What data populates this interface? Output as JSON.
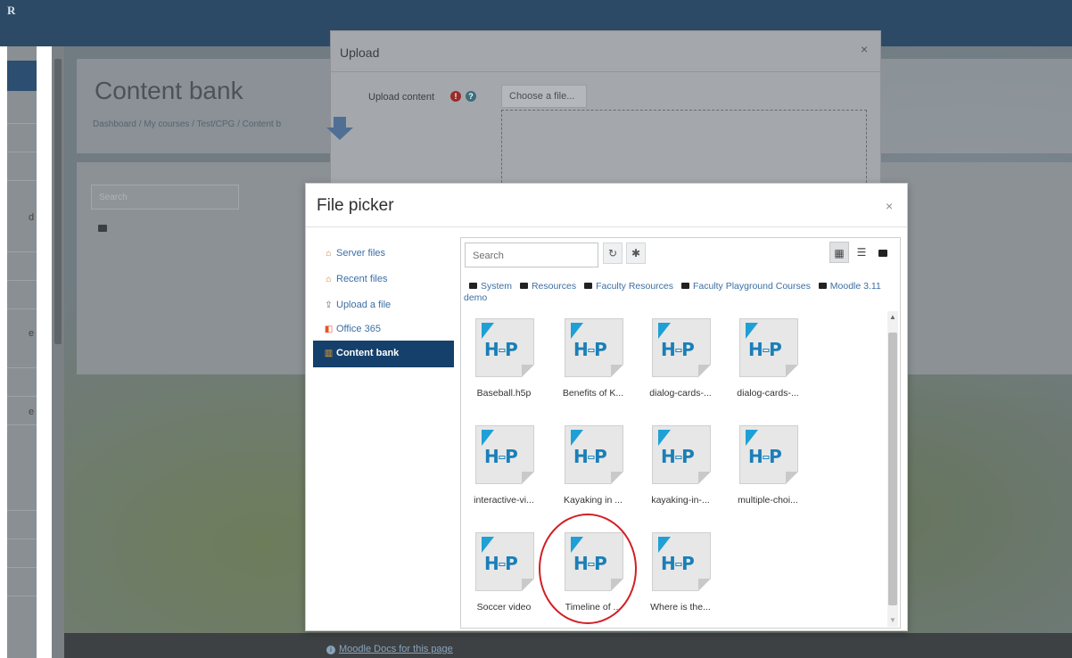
{
  "background": {
    "logo_text": "R",
    "page_title": "Content bank",
    "breadcrumb": "Dashboard / My courses / Test/CPG / Content b",
    "search_placeholder": "Search",
    "sidebar_fragments": [
      "d",
      "e",
      "e"
    ],
    "footer_link": "Moodle Docs for this page"
  },
  "upload_dialog": {
    "title": "Upload",
    "close": "×",
    "label": "Upload content",
    "choose_button": "Choose a file..."
  },
  "file_picker": {
    "title": "File picker",
    "close": "×",
    "repositories": [
      {
        "label": "Server files",
        "icon": "folder-tree-icon",
        "active": false
      },
      {
        "label": "Recent files",
        "icon": "folder-tree-icon",
        "active": false
      },
      {
        "label": "Upload a file",
        "icon": "upload-icon",
        "active": false
      },
      {
        "label": "Office 365",
        "icon": "office-icon",
        "active": false
      },
      {
        "label": "Content bank",
        "icon": "content-bank-icon",
        "active": true
      }
    ],
    "search_placeholder": "Search",
    "path": [
      "System",
      "Resources",
      "Faculty Resources",
      "Faculty Playground Courses",
      "Moodle 3.11 demo"
    ],
    "files": [
      "Baseball.h5p",
      "Benefits of K...",
      "dialog-cards-...",
      "dialog-cards-...",
      "interactive-vi...",
      "Kayaking in ...",
      "kayaking-in-...",
      "multiple-choi...",
      "Soccer video",
      "Timeline of ...",
      "Where is the..."
    ],
    "highlighted_file_index": 9
  },
  "colors": {
    "accent": "#15406b",
    "link": "#3b6fa5",
    "h5p_blue": "#1a7fb8",
    "annotation": "#d21f25"
  }
}
